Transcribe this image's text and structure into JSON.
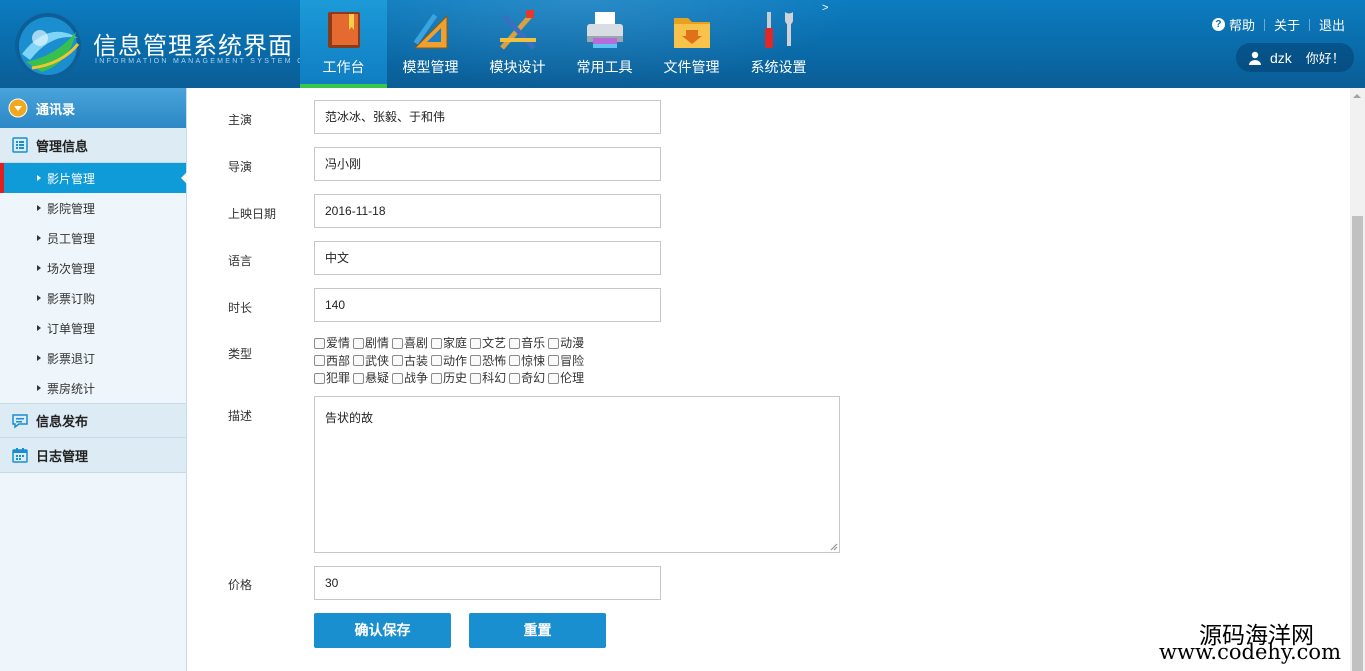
{
  "header": {
    "title": "信息管理系统界面",
    "subtitle": "INFORMATION MANAGEMENT SYSTEM GUI",
    "nav": [
      {
        "label": "工作台",
        "icon": "book-icon",
        "active": true
      },
      {
        "label": "模型管理",
        "icon": "ruler-icon",
        "active": false
      },
      {
        "label": "模块设计",
        "icon": "design-tools-icon",
        "active": false
      },
      {
        "label": "常用工具",
        "icon": "printer-icon",
        "active": false
      },
      {
        "label": "文件管理",
        "icon": "folder-icon",
        "active": false
      },
      {
        "label": "系统设置",
        "icon": "wrench-screwdriver-icon",
        "active": false
      }
    ],
    "more": ">",
    "links": {
      "help": "帮助",
      "about": "关于",
      "logout": "退出"
    },
    "user": {
      "name": "dzk",
      "greeting": "你好！"
    }
  },
  "sidebar": {
    "groups": [
      {
        "label": "通讯录",
        "icon": "dropdown-circle-icon"
      },
      {
        "label": "管理信息",
        "icon": "list-icon"
      },
      {
        "label": "信息发布",
        "icon": "message-icon"
      },
      {
        "label": "日志管理",
        "icon": "calendar-icon"
      }
    ],
    "items": [
      "影片管理",
      "影院管理",
      "员工管理",
      "场次管理",
      "影票订购",
      "订单管理",
      "影票退订",
      "票房统计"
    ],
    "active_item": "影片管理"
  },
  "form": {
    "actors": {
      "label": "主演",
      "value": "范冰冰、张毅、于和伟"
    },
    "director": {
      "label": "导演",
      "value": "冯小刚"
    },
    "release_date": {
      "label": "上映日期",
      "value": "2016-11-18"
    },
    "language": {
      "label": "语言",
      "value": "中文"
    },
    "duration": {
      "label": "时长",
      "value": "140"
    },
    "genre": {
      "label": "类型",
      "options": [
        "爱情",
        "剧情",
        "喜剧",
        "家庭",
        "文艺",
        "音乐",
        "动漫",
        "西部",
        "武侠",
        "古装",
        "动作",
        "恐怖",
        "惊悚",
        "冒险",
        "犯罪",
        "悬疑",
        "战争",
        "历史",
        "科幻",
        "奇幻",
        "伦理"
      ]
    },
    "description": {
      "label": "描述",
      "value": "告状的故"
    },
    "price": {
      "label": "价格",
      "value": "30"
    },
    "save_label": "确认保存",
    "reset_label": "重置"
  },
  "watermark": {
    "line1": "源码海洋网",
    "line2": "www.codehy.com"
  },
  "colors": {
    "header": "#0a6aa8",
    "accent": "#1a8fcf",
    "active_tab_bar": "#39c64a",
    "active_marker": "#e02020"
  }
}
